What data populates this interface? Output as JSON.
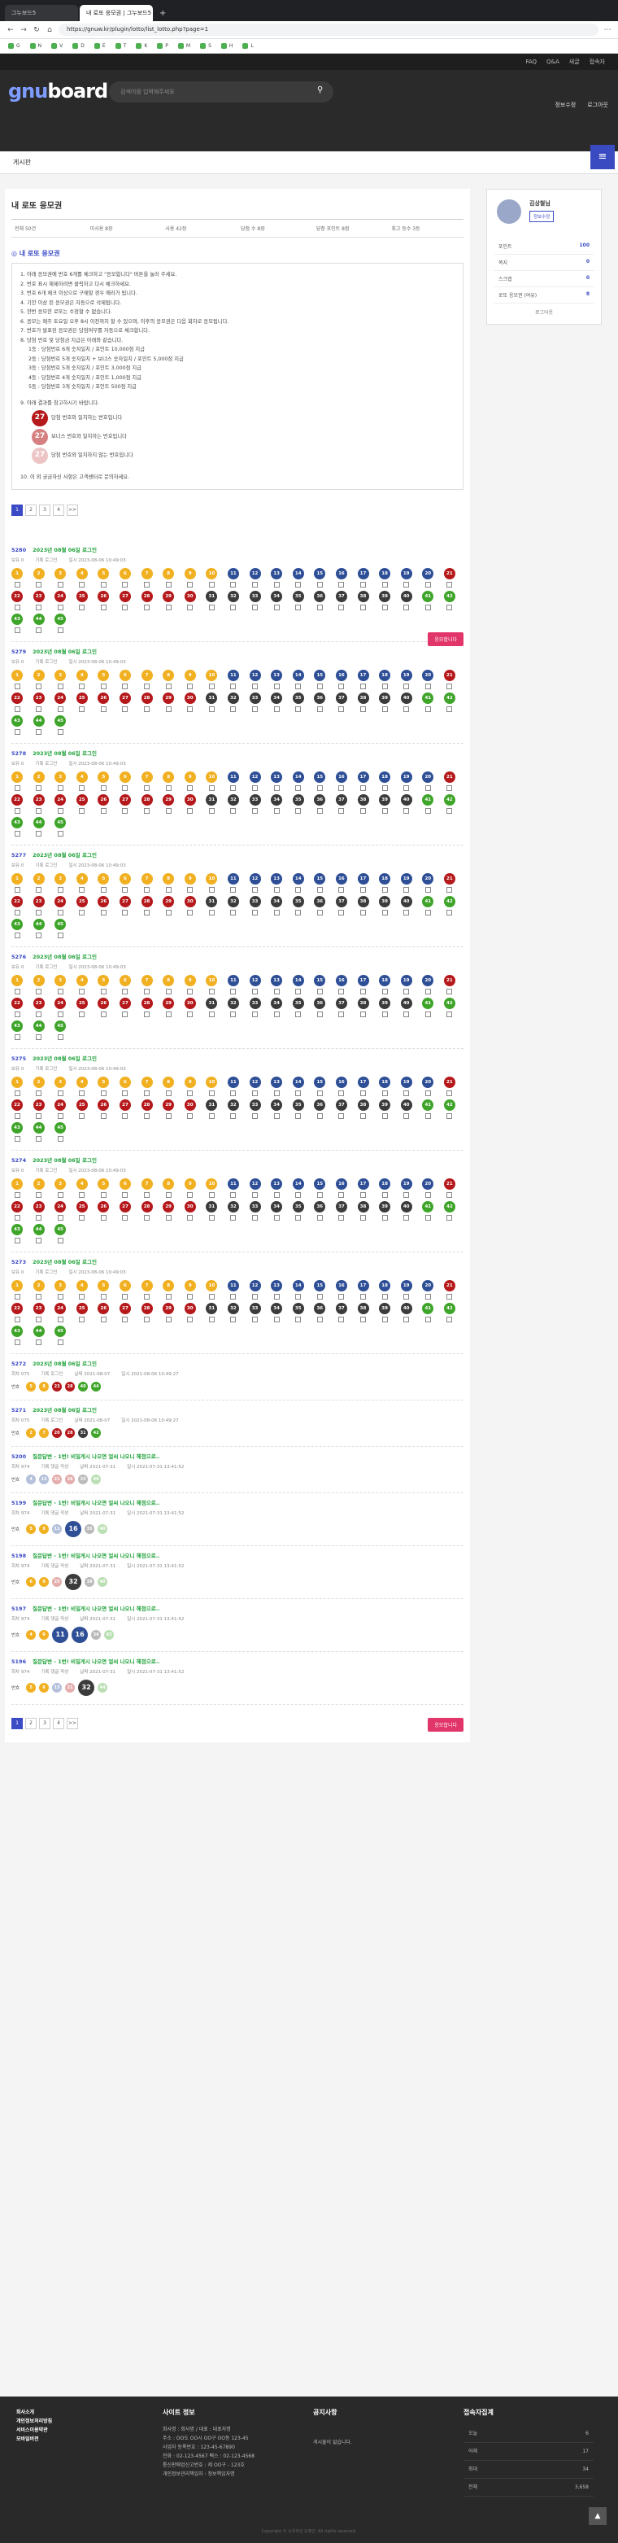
{
  "browser": {
    "tabs": [
      "그누보드5",
      "내 로또 응모권 | 그누보드5"
    ],
    "url": "https://gnuw.kr/plugin/lotto/list_lotto.php?page=1"
  },
  "topnav": [
    "FAQ",
    "Q&A",
    "새글",
    "접속자"
  ],
  "header": {
    "logo_a": "gnu",
    "logo_b": "board",
    "search_placeholder": "검색어를 입력해주세요",
    "links": [
      "정보수정",
      "로그아웃"
    ]
  },
  "breadcrumb": "게시판",
  "page_title": "내 로또 응모권",
  "stats": [
    "전체 50건",
    "미사용 8장",
    "사용 42장",
    "당첨 수 8장",
    "당첨 포인트 8점",
    "최고 등수 3등"
  ],
  "rules_title": "◎ 내 로또 응모권",
  "rules": [
    "1. 아래 응모권에 번호 6개를 체크하고 \"응모합니다\" 버튼을 눌러 주세요.",
    "2. 번호 표시 해제하려면 클릭하고 다시 체크하세요.",
    "3. 번호 6개 체크 이상으로 구매할 경우 에러가 됩니다.",
    "4. 기한 이상 된 응모권은 자동으로 삭제됩니다.",
    "5. 한번 응모한 로또는 수정할 수 없습니다.",
    "6. 응모는 매주 토요일 오후 8시 이전까지 할 수 있으며, 이후의 응모권은 다음 회차로 응모됩니다.",
    "7. 번호가 발표된 응모권은 당첨여부를 자동으로 체크합니다.",
    "8. 당첨 번호 및 당첨금 지급은 아래와 같습니다."
  ],
  "prizes": [
    "1등 : 당첨번호 6개 숫자일치 / 포인트 10,000점 지급",
    "2등 : 당첨번호 5개 숫자일치 + 보너스 숫자일치 / 포인트 5,000점 지급",
    "3등 : 당첨번호 5개 숫자일치 / 포인트 3,000점 지급",
    "4등 : 당첨번호 4개 숫자일치 / 포인트 1,000점 지급",
    "5등 : 당첨번호 3개 숫자일치 / 포인트 500점 지급"
  ],
  "rule9": "9. 아래 결과를 참고하시기 바랍니다.",
  "legend": [
    {
      "n": "27",
      "text": "당첨 번호와 일치하는 번호입니다"
    },
    {
      "n": "27",
      "text": "보너스 번호와 일치하는 번호입니다"
    },
    {
      "n": "27",
      "text": "당첨 번호와 일치하지 않는 번호입니다"
    }
  ],
  "rule10": "10. 이 외 궁금하신 사항은 고객센터로 문의하세요.",
  "pager": [
    "1",
    "2",
    "3",
    "4",
    ">>"
  ],
  "register_label": "응모합니다",
  "entries": [
    {
      "no": "5280",
      "title": "2023년 08월 06일 로그인",
      "meta": [
        "보유 0",
        "기록 로그인",
        "일시 2023-08-06 10:49:03"
      ]
    },
    {
      "no": "5279",
      "title": "2023년 08월 06일 로그인",
      "meta": [
        "보유 0",
        "기록 로그인",
        "일시 2023-08-06 10:49:03"
      ]
    },
    {
      "no": "5278",
      "title": "2023년 08월 06일 로그인",
      "meta": [
        "보유 0",
        "기록 로그인",
        "일시 2023-08-06 10:49:03"
      ]
    },
    {
      "no": "5277",
      "title": "2023년 08월 06일 로그인",
      "meta": [
        "보유 0",
        "기록 로그인",
        "일시 2023-08-06 10:49:03"
      ]
    },
    {
      "no": "5276",
      "title": "2023년 08월 06일 로그인",
      "meta": [
        "보유 0",
        "기록 로그인",
        "일시 2023-08-06 10:49:03"
      ]
    },
    {
      "no": "5275",
      "title": "2023년 08월 06일 로그인",
      "meta": [
        "보유 0",
        "기록 로그인",
        "일시 2023-08-06 10:49:03"
      ]
    },
    {
      "no": "5274",
      "title": "2023년 08월 06일 로그인",
      "meta": [
        "보유 0",
        "기록 로그인",
        "일시 2023-08-06 10:49:03"
      ]
    },
    {
      "no": "5273",
      "title": "2023년 08월 06일 로그인",
      "meta": [
        "보유 0",
        "기록 로그인",
        "일시 2023-08-06 10:49:03"
      ]
    }
  ],
  "used_entries": [
    {
      "no": "5272",
      "title": "2023년 08월 06일 로그인",
      "meta": [
        "회차 075",
        "기록 로그인",
        "날짜 2021-08-07",
        "일시 2021-08-06 10:49:27"
      ],
      "pick_label": "번호",
      "picks": [
        [
          "5",
          "y",
          0
        ],
        [
          "8",
          "y",
          0
        ],
        [
          "23",
          "r",
          0
        ],
        [
          "28",
          "r",
          0
        ],
        [
          "40",
          "g",
          0
        ],
        [
          "44",
          "g",
          0
        ]
      ]
    },
    {
      "no": "5271",
      "title": "2023년 08월 06일 로그인",
      "meta": [
        "회차 075",
        "기록 로그인",
        "날짜 2021-08-07",
        "일시 2021-08-06 10:49:27"
      ],
      "pick_label": "번호",
      "picks": [
        [
          "2",
          "y",
          0
        ],
        [
          "7",
          "y",
          0
        ],
        [
          "20",
          "r",
          0
        ],
        [
          "28",
          "r",
          0
        ],
        [
          "31",
          "k",
          0
        ],
        [
          "42",
          "g",
          0
        ]
      ]
    },
    {
      "no": "5200",
      "title": "질문답변 - 1번! 비밀게시 나오면 얼씨 나오니 해점으로..",
      "meta": [
        "회차 974",
        "기록 댓글 작성",
        "날짜 2021-07-31",
        "일시 2021-07-31 13:41:52"
      ],
      "pick_label": "번호",
      "picks": [
        [
          "4",
          "b",
          1
        ],
        [
          "15",
          "b",
          1
        ],
        [
          "21",
          "r",
          1
        ],
        [
          "26",
          "r",
          1
        ],
        [
          "33",
          "k",
          1
        ],
        [
          "40",
          "g",
          1
        ]
      ]
    },
    {
      "no": "5199",
      "title": "질문답변 - 1번! 비밀게시 나오면 얼씨 나오니 해점으로..",
      "meta": [
        "회차 974",
        "기록 댓글 작성",
        "날짜 2021-07-31",
        "일시 2021-07-31 13:41:52"
      ],
      "pick_label": "번호",
      "picks": [
        [
          "5",
          "y",
          0
        ],
        [
          "9",
          "y",
          0
        ],
        [
          "11",
          "b",
          1
        ],
        [
          "16",
          "b",
          2
        ],
        [
          "35",
          "k",
          1
        ],
        [
          "40",
          "g",
          1
        ]
      ]
    },
    {
      "no": "5198",
      "title": "질문답변 - 1번! 비밀게시 나오면 얼씨 나오니 해점으로..",
      "meta": [
        "회차 974",
        "기록 댓글 작성",
        "날짜 2021-07-31",
        "일시 2021-07-31 13:41:52"
      ],
      "pick_label": "번호",
      "picks": [
        [
          "6",
          "y",
          0
        ],
        [
          "9",
          "y",
          0
        ],
        [
          "25",
          "r",
          1
        ],
        [
          "32",
          "k",
          2
        ],
        [
          "38",
          "k",
          1
        ],
        [
          "40",
          "g",
          1
        ]
      ]
    },
    {
      "no": "5197",
      "title": "질문답변 - 1번! 비밀게시 나오면 얼씨 나오니 해점으로..",
      "meta": [
        "회차 974",
        "기록 댓글 작성",
        "날짜 2021-07-31",
        "일시 2021-07-31 13:41:52"
      ],
      "pick_label": "번호",
      "picks": [
        [
          "4",
          "y",
          0
        ],
        [
          "6",
          "y",
          0
        ],
        [
          "11",
          "b",
          2
        ],
        [
          "16",
          "b",
          2
        ],
        [
          "34",
          "k",
          1
        ],
        [
          "43",
          "g",
          1
        ]
      ]
    },
    {
      "no": "5196",
      "title": "질문답변 - 1번! 비밀게시 나오면 얼씨 나오니 해점으로..",
      "meta": [
        "회차 974",
        "기록 댓글 작성",
        "날짜 2021-07-31",
        "일시 2021-07-31 13:41:52"
      ],
      "pick_label": "번호",
      "picks": [
        [
          "5",
          "y",
          0
        ],
        [
          "6",
          "y",
          0
        ],
        [
          "15",
          "b",
          1
        ],
        [
          "21",
          "r",
          1
        ],
        [
          "32",
          "k",
          2
        ],
        [
          "44",
          "g",
          1
        ]
      ]
    }
  ],
  "side": {
    "name": "김상철님",
    "btn": "정보수정",
    "rows": [
      [
        "포인트",
        "100"
      ],
      [
        "쪽지",
        "0"
      ],
      [
        "스크랩",
        "0"
      ],
      [
        "로또 응모권 (여유)",
        "8"
      ]
    ],
    "logout": "로그아웃"
  },
  "footer": {
    "links": [
      "회사소개",
      "개인정보처리방침",
      "서비스이용약관",
      "모바일버전"
    ],
    "info_title": "사이트 정보",
    "info": [
      "회사명 : 회사명 / 대표 : 대표자명",
      "주소 : OO도 OO시 OO구 OO동 123-45",
      "사업자 등록번호 : 123-45-67890",
      "전화 : 02-123-4567 팩스 : 02-123-4568",
      "통신판매업신고번호 : 제 OO구 - 123호",
      "개인정보관리책임자 : 정보책임자명"
    ],
    "notice_title": "공지사항",
    "notice": "게시물이 없습니다.",
    "visit_title": "접속자집계",
    "visits": [
      [
        "오늘",
        "6"
      ],
      [
        "어제",
        "17"
      ],
      [
        "최대",
        "34"
      ],
      [
        "전체",
        "3,658"
      ]
    ],
    "copy": "Copyright © 소유하신 도메인. All rights reserved."
  },
  "colors": {
    "accent": "#3b4bc5",
    "register": "#e2366b"
  }
}
